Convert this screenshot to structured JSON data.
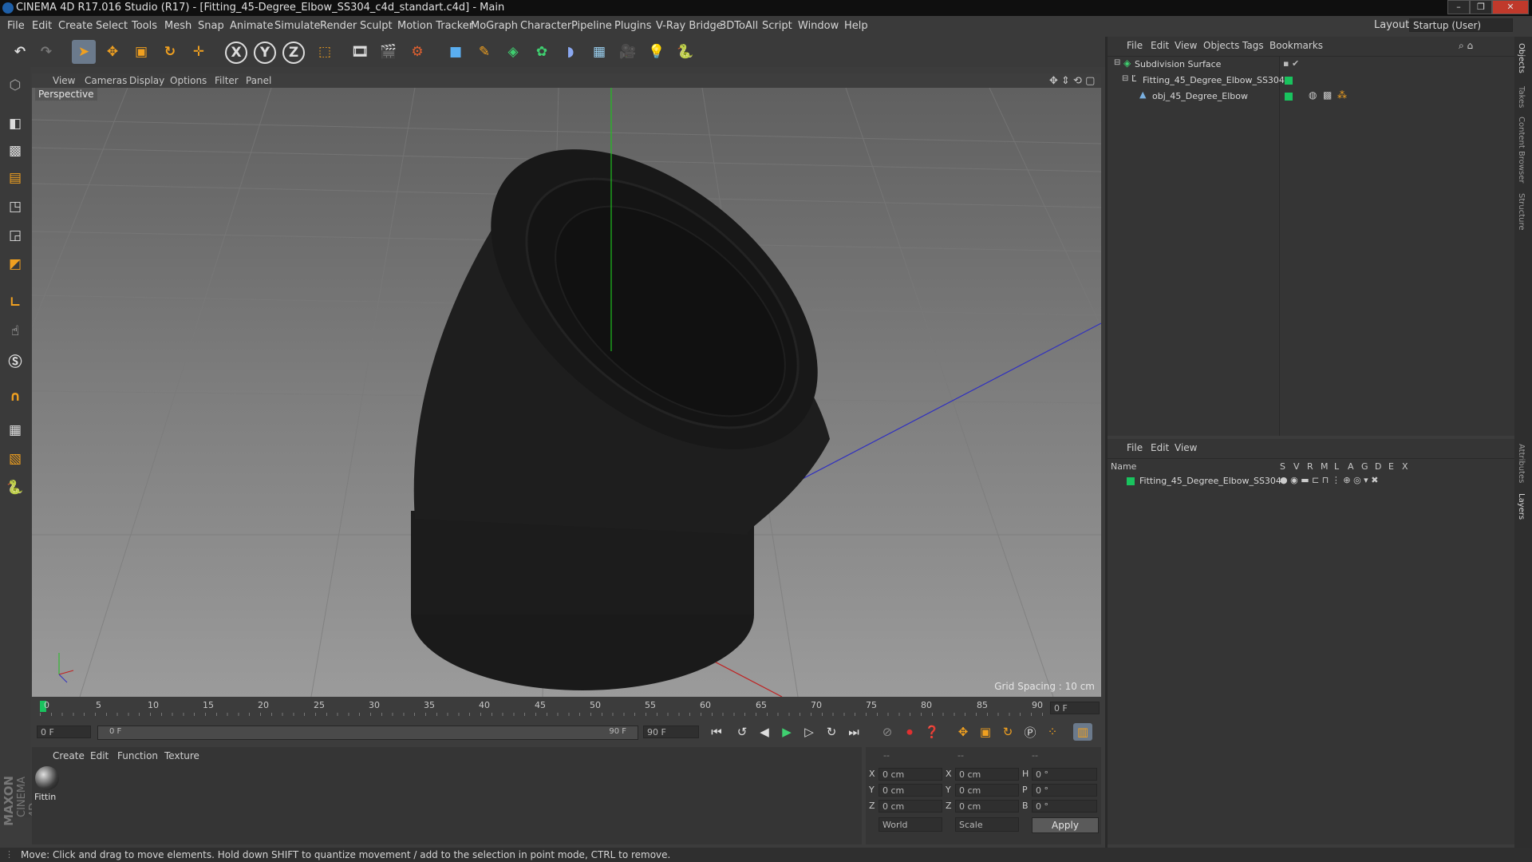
{
  "window": {
    "title": "CINEMA 4D R17.016 Studio (R17) - [Fitting_45-Degree_Elbow_SS304_c4d_standart.c4d] - Main",
    "controls": [
      "–",
      "❐",
      "✕"
    ]
  },
  "menubar": {
    "items": [
      "File",
      "Edit",
      "Create",
      "Select",
      "Tools",
      "Mesh",
      "Snap",
      "Animate",
      "Simulate",
      "Render",
      "Sculpt",
      "Motion Tracker",
      "MoGraph",
      "Character",
      "Pipeline",
      "Plugins",
      "V-Ray Bridge",
      "3DToAll",
      "Script",
      "Window",
      "Help"
    ],
    "layout_label": "Layout:",
    "layout_value": "Startup (User)"
  },
  "toolbar": {
    "axis_x": "X",
    "axis_y": "Y",
    "axis_z": "Z"
  },
  "viewport": {
    "menu": [
      "View",
      "Cameras",
      "Display",
      "Options",
      "Filter",
      "Panel"
    ],
    "label": "Perspective",
    "grid_spacing": "Grid Spacing : 10 cm"
  },
  "timeline": {
    "ticks": [
      "0",
      "5",
      "10",
      "15",
      "20",
      "25",
      "30",
      "35",
      "40",
      "45",
      "50",
      "55",
      "60",
      "65",
      "70",
      "75",
      "80",
      "85",
      "90"
    ],
    "current_frame_field": "0 F",
    "start_field": "0 F",
    "range_start": "0 F",
    "range_end": "90 F",
    "end_field": "90 F"
  },
  "material_manager": {
    "menu": [
      "Create",
      "Edit",
      "Function",
      "Texture"
    ],
    "material_name": "Fittin"
  },
  "coordinates": {
    "header": [
      "--",
      "--",
      "--"
    ],
    "rows": [
      {
        "a": "X",
        "av": "0 cm",
        "b": "X",
        "bv": "0 cm",
        "c": "H",
        "cv": "0 °"
      },
      {
        "a": "Y",
        "av": "0 cm",
        "b": "Y",
        "bv": "0 cm",
        "c": "P",
        "cv": "0 °"
      },
      {
        "a": "Z",
        "av": "0 cm",
        "b": "Z",
        "bv": "0 cm",
        "c": "B",
        "cv": "0 °"
      }
    ],
    "world": "World",
    "scale": "Scale",
    "apply": "Apply"
  },
  "object_manager": {
    "menu": [
      "File",
      "Edit",
      "View",
      "Objects",
      "Tags",
      "Bookmarks"
    ],
    "objects": [
      "Subdivision Surface",
      "Fitting_45_Degree_Elbow_SS304",
      "obj_45_Degree_Elbow"
    ]
  },
  "layer_manager": {
    "menu": [
      "File",
      "Edit",
      "View"
    ],
    "columns": [
      "Name",
      "S",
      "V",
      "R",
      "M",
      "L",
      "A",
      "G",
      "D",
      "E",
      "X"
    ],
    "layer": "Fitting_45_Degree_Elbow_SS304"
  },
  "right_tabs": [
    "Objects",
    "Takes",
    "Content Browser",
    "Structure",
    "Attributes",
    "Layers"
  ],
  "brand": {
    "maxon": "MAXON",
    "cinema": "CINEMA 4D"
  },
  "status": "Move: Click and drag to move elements. Hold down SHIFT to quantize movement / add to the selection in point mode, CTRL to remove.",
  "colors": {
    "accent": "#f0a020",
    "green": "#19c35e",
    "select": "#6b7a8c"
  }
}
